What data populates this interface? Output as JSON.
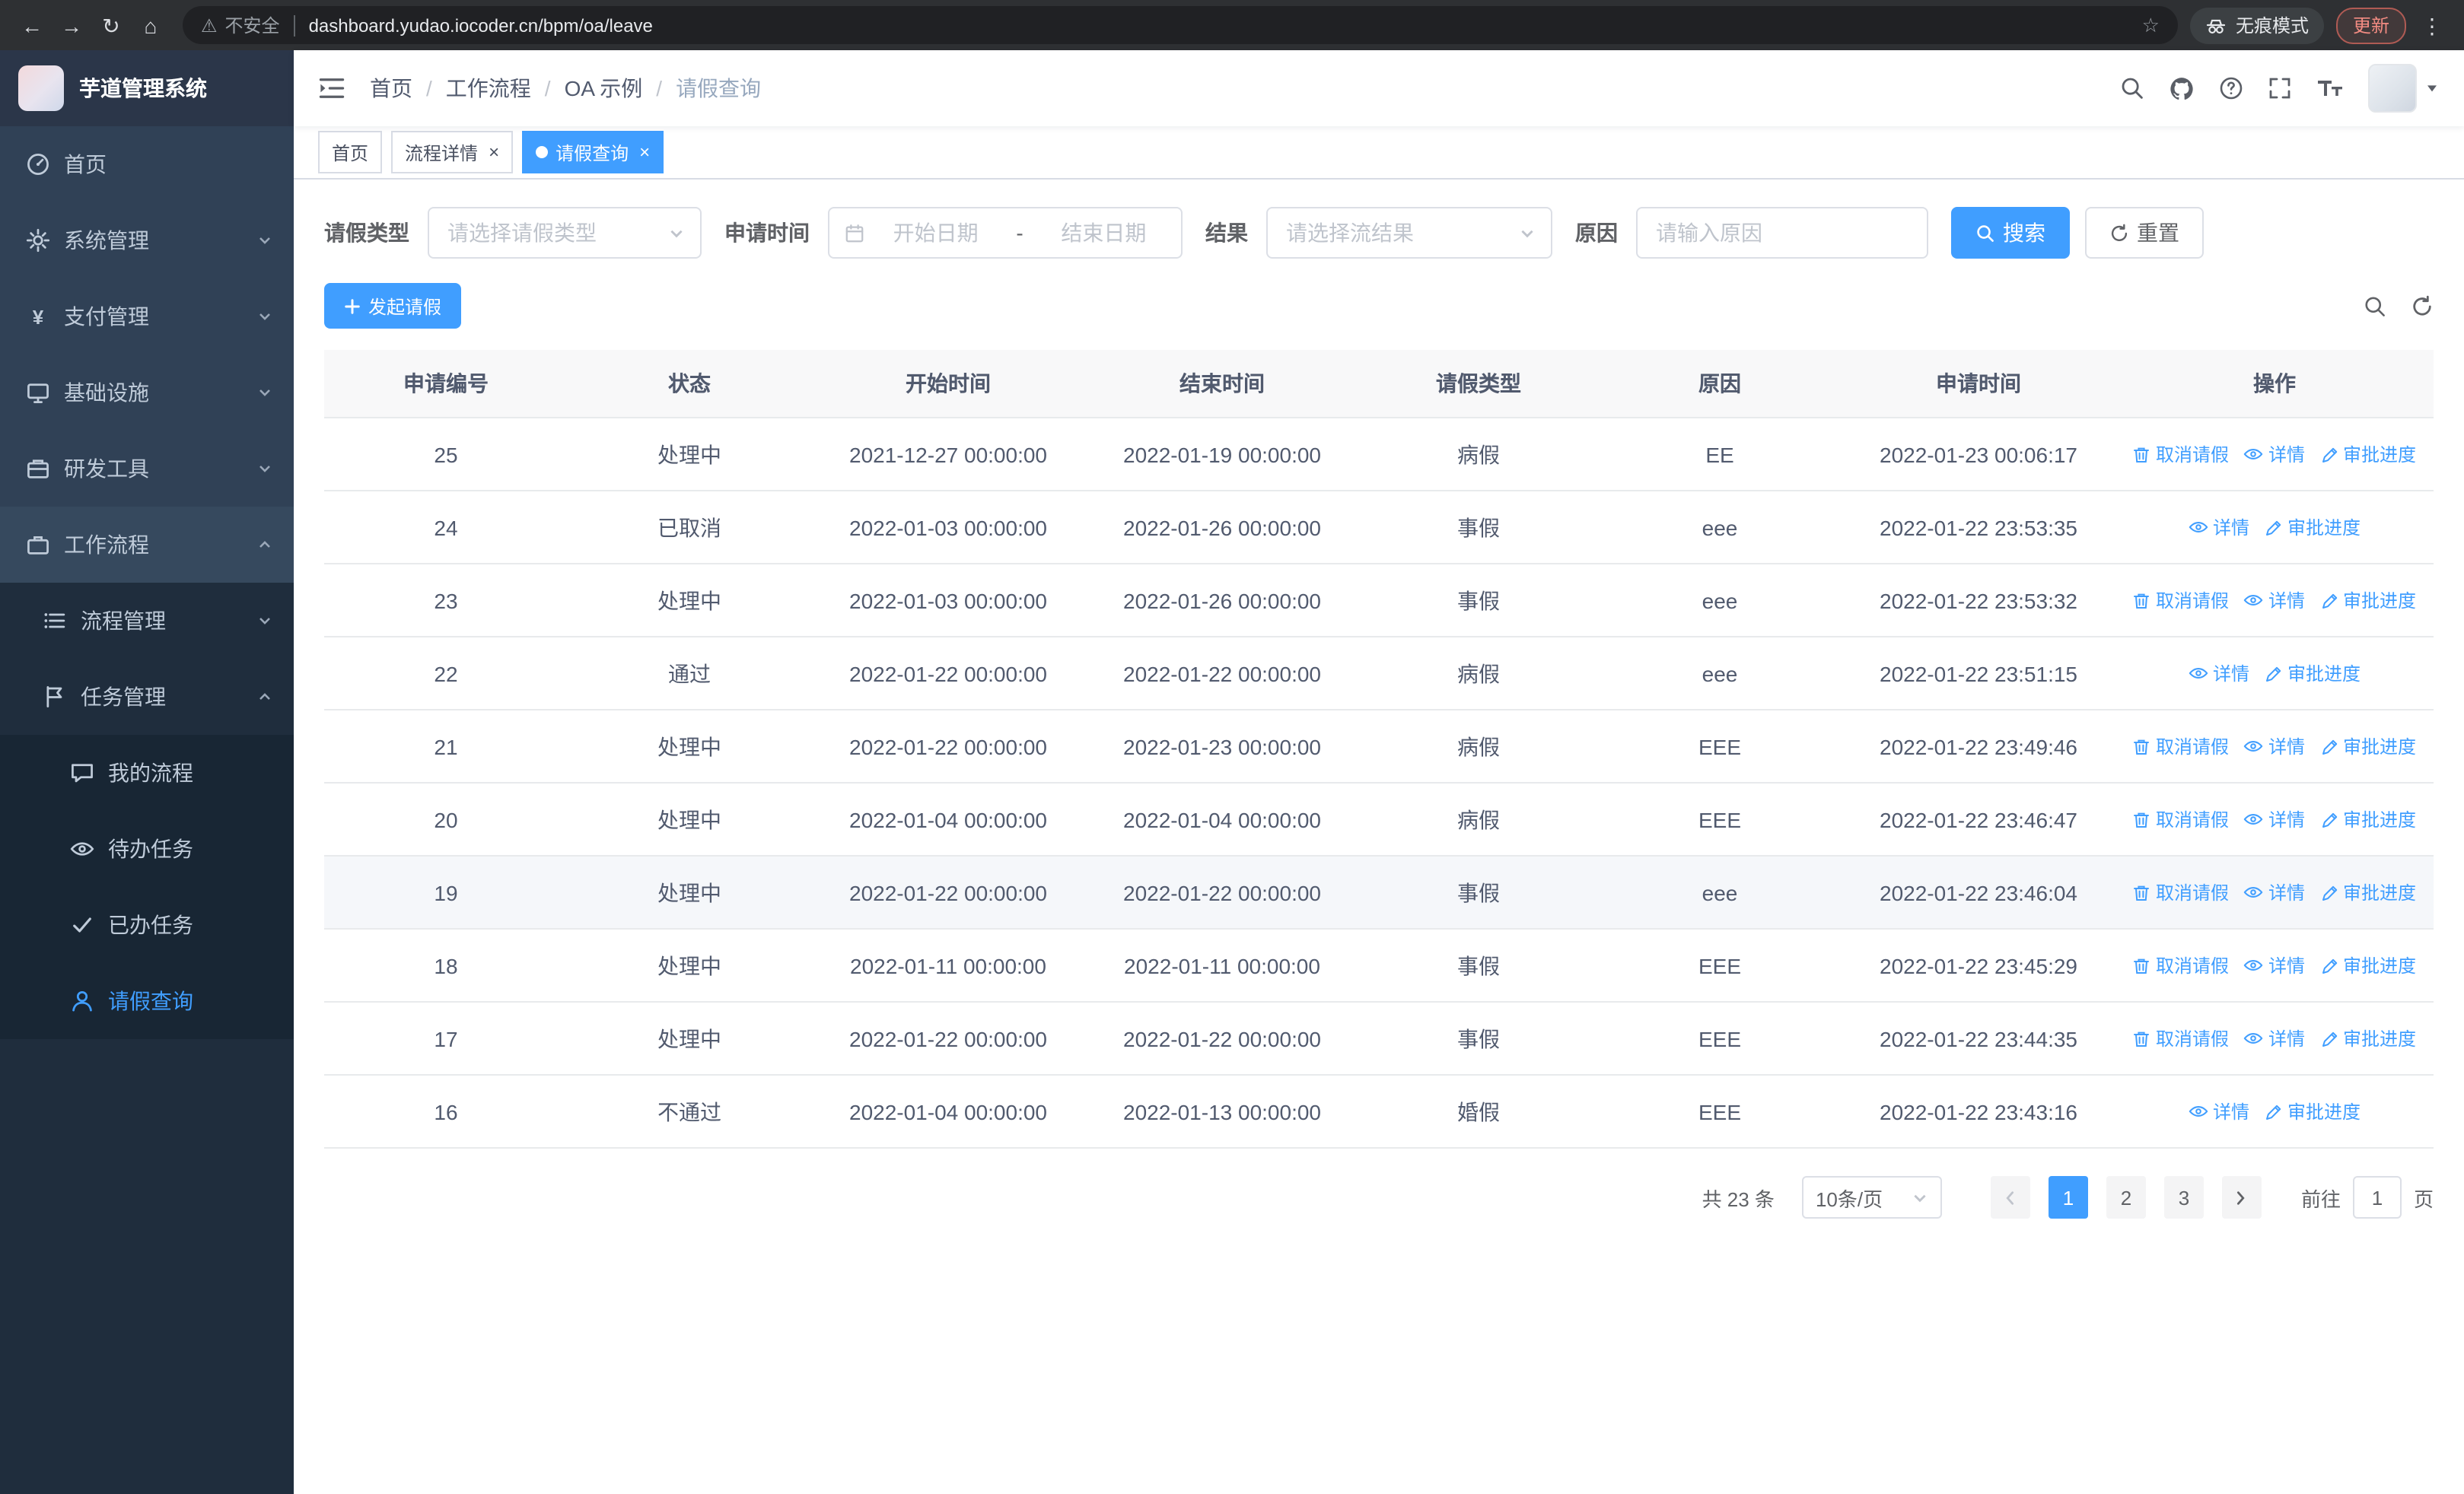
{
  "browser": {
    "security_label": "不安全",
    "url": "dashboard.yudao.iocoder.cn/bpm/oa/leave",
    "incognito_label": "无痕模式",
    "update_label": "更新"
  },
  "icons": {
    "back": "←",
    "forward": "→",
    "reload": "↻",
    "home": "⌂",
    "warning": "⚠",
    "star": "☆",
    "kebab": "⋮",
    "close": "×",
    "yen": "¥"
  },
  "sidebar": {
    "logo_title": "芋道管理系统",
    "items": [
      {
        "label": "首页",
        "icon": "dashboard-icon"
      },
      {
        "label": "系统管理",
        "icon": "gear-icon"
      },
      {
        "label": "支付管理",
        "icon": "yen-icon"
      },
      {
        "label": "基础设施",
        "icon": "monitor-icon"
      },
      {
        "label": "研发工具",
        "icon": "toolbox-icon"
      },
      {
        "label": "工作流程",
        "icon": "briefcase-icon"
      }
    ],
    "workflow_children": [
      {
        "label": "流程管理",
        "icon": "list-icon"
      },
      {
        "label": "任务管理",
        "icon": "flag-icon"
      }
    ],
    "task_children": [
      {
        "label": "我的流程",
        "icon": "chat-icon"
      },
      {
        "label": "待办任务",
        "icon": "eye-icon"
      },
      {
        "label": "已办任务",
        "icon": "check-icon"
      },
      {
        "label": "请假查询",
        "icon": "user-icon"
      }
    ]
  },
  "header": {
    "breadcrumb": [
      "首页",
      "工作流程",
      "OA 示例",
      "请假查询"
    ]
  },
  "tabs": [
    {
      "label": "首页"
    },
    {
      "label": "流程详情"
    },
    {
      "label": "请假查询"
    }
  ],
  "filters": {
    "leave_type_label": "请假类型",
    "leave_type_placeholder": "请选择请假类型",
    "apply_time_label": "申请时间",
    "start_date_placeholder": "开始日期",
    "date_separator": "-",
    "end_date_placeholder": "结束日期",
    "result_label": "结果",
    "result_placeholder": "请选择流结果",
    "reason_label": "原因",
    "reason_placeholder": "请输入原因",
    "search_button": "搜索",
    "reset_button": "重置"
  },
  "toolbar": {
    "create_button": "发起请假"
  },
  "table": {
    "columns": [
      "申请编号",
      "状态",
      "开始时间",
      "结束时间",
      "请假类型",
      "原因",
      "申请时间",
      "操作"
    ],
    "action_labels": {
      "cancel": "取消请假",
      "detail": "详情",
      "progress": "审批进度"
    },
    "rows": [
      {
        "id": "25",
        "status": "处理中",
        "start": "2021-12-27 00:00:00",
        "end": "2022-01-19 00:00:00",
        "type": "病假",
        "reason": "EE",
        "applied": "2022-01-23 00:06:17",
        "cancelable": true,
        "highlighted": false
      },
      {
        "id": "24",
        "status": "已取消",
        "start": "2022-01-03 00:00:00",
        "end": "2022-01-26 00:00:00",
        "type": "事假",
        "reason": "eee",
        "applied": "2022-01-22 23:53:35",
        "cancelable": false,
        "highlighted": false
      },
      {
        "id": "23",
        "status": "处理中",
        "start": "2022-01-03 00:00:00",
        "end": "2022-01-26 00:00:00",
        "type": "事假",
        "reason": "eee",
        "applied": "2022-01-22 23:53:32",
        "cancelable": true,
        "highlighted": false
      },
      {
        "id": "22",
        "status": "通过",
        "start": "2022-01-22 00:00:00",
        "end": "2022-01-22 00:00:00",
        "type": "病假",
        "reason": "eee",
        "applied": "2022-01-22 23:51:15",
        "cancelable": false,
        "highlighted": false
      },
      {
        "id": "21",
        "status": "处理中",
        "start": "2022-01-22 00:00:00",
        "end": "2022-01-23 00:00:00",
        "type": "病假",
        "reason": "EEE",
        "applied": "2022-01-22 23:49:46",
        "cancelable": true,
        "highlighted": false
      },
      {
        "id": "20",
        "status": "处理中",
        "start": "2022-01-04 00:00:00",
        "end": "2022-01-04 00:00:00",
        "type": "病假",
        "reason": "EEE",
        "applied": "2022-01-22 23:46:47",
        "cancelable": true,
        "highlighted": false
      },
      {
        "id": "19",
        "status": "处理中",
        "start": "2022-01-22 00:00:00",
        "end": "2022-01-22 00:00:00",
        "type": "事假",
        "reason": "eee",
        "applied": "2022-01-22 23:46:04",
        "cancelable": true,
        "highlighted": true
      },
      {
        "id": "18",
        "status": "处理中",
        "start": "2022-01-11 00:00:00",
        "end": "2022-01-11 00:00:00",
        "type": "事假",
        "reason": "EEE",
        "applied": "2022-01-22 23:45:29",
        "cancelable": true,
        "highlighted": false
      },
      {
        "id": "17",
        "status": "处理中",
        "start": "2022-01-22 00:00:00",
        "end": "2022-01-22 00:00:00",
        "type": "事假",
        "reason": "EEE",
        "applied": "2022-01-22 23:44:35",
        "cancelable": true,
        "highlighted": false
      },
      {
        "id": "16",
        "status": "不通过",
        "start": "2022-01-04 00:00:00",
        "end": "2022-01-13 00:00:00",
        "type": "婚假",
        "reason": "EEE",
        "applied": "2022-01-22 23:43:16",
        "cancelable": false,
        "highlighted": false
      }
    ]
  },
  "pagination": {
    "total_text": "共 23 条",
    "page_size": "10条/页",
    "pages": [
      "1",
      "2",
      "3"
    ],
    "active_page": "1",
    "goto_prefix": "前往",
    "goto_value": "1",
    "goto_suffix": "页"
  }
}
